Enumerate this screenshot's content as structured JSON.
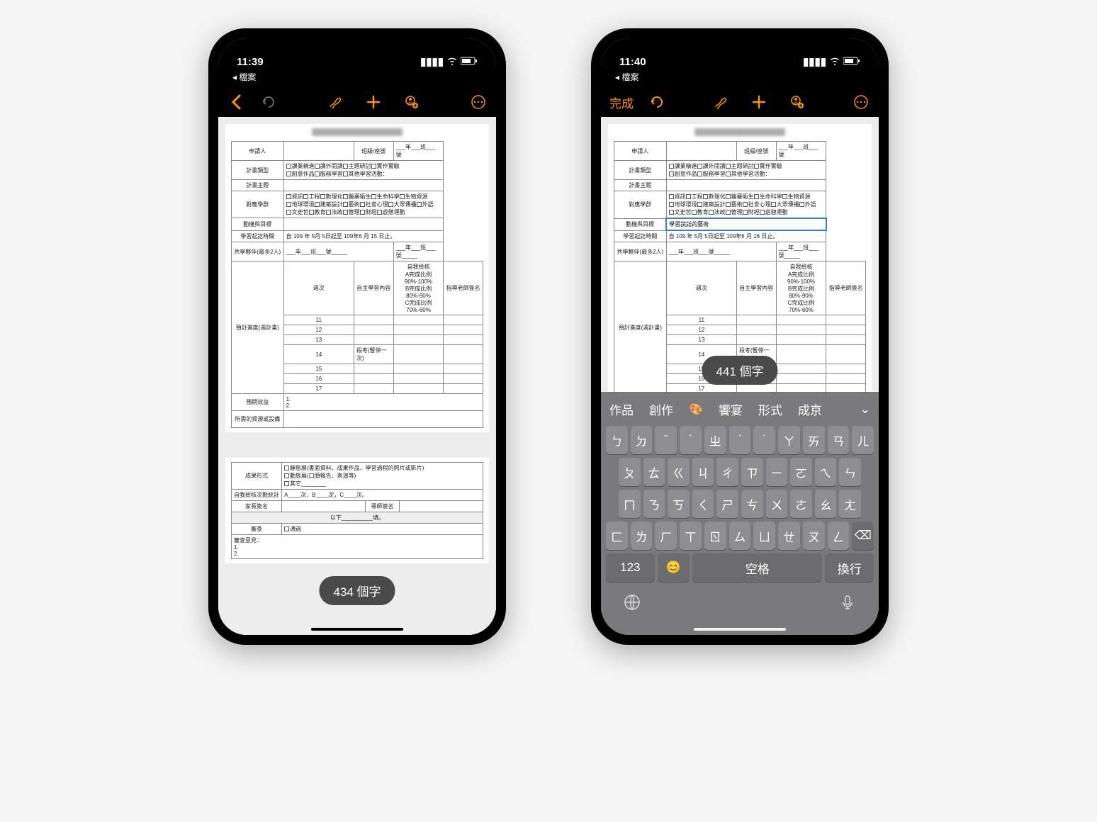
{
  "left": {
    "status_time": "11:39",
    "back_app": "◂ 檔案",
    "word_pill": "434 個字"
  },
  "right": {
    "status_time": "11:40",
    "back_app": "◂ 檔案",
    "done_label": "完成",
    "editing_text": "學習說話的藝術",
    "word_pill": "441 個字"
  },
  "form": {
    "r1_c1": "申請人",
    "r1_c3": "班級/座號",
    "r1_c4": "___年___班___號",
    "r2_c1": "計畫類型",
    "r2_opts": [
      "課業精進",
      "課外閱讀",
      "主題研討",
      "實作實驗",
      "創意作品",
      "服務學習",
      "其他學習活動："
    ],
    "r3_c1": "計畫主題",
    "r4_c1": "對應學群",
    "r4_opts": [
      "資訊",
      "工程",
      "數理化",
      "醫藥衛生",
      "生命科學",
      "生物資源",
      "地球環境",
      "建築設計",
      "藝術",
      "社會心理",
      "大眾傳播",
      "外語",
      "文史哲",
      "教育",
      "法政",
      "管理",
      "財經",
      "遊憩運動"
    ],
    "r5_c1": "動機與目標",
    "r6_c1": "學習起訖時間",
    "r6_c2": "自 109 年 5月 5日起至 109年6 月 15 日止。",
    "r6b_c2": "自 109 年 5月 5日起至 109年6 月 16 日止。",
    "r7_c1": "共學夥伴(最多2人)",
    "r7_c2a": "___年___班___號_____",
    "r7_c2b": "___年___班___號_____",
    "r8_c1": "預計進度(週計畫)",
    "r8_h1": "週次",
    "r8_h2": "自主學習內容",
    "r8_h3": "自我檢核",
    "r8_h3_sub": "A完成比例90%-100%\nB完成比例80%-90%\nC完成比例70%-60%",
    "r8_h4": "指導老師簽名",
    "weeks": [
      "11",
      "12",
      "13",
      "14",
      "15",
      "16",
      "17"
    ],
    "w14_note": "段考(暫停一次)",
    "r9_c1": "預期效益",
    "r9_c2": "1.\n2.",
    "r10_c1": "所需的資源或設備",
    "p2_r1_c1": "成果形式",
    "p2_r1_opts": [
      "靜態展(書面資料、成果作品、學習過程的照片或影片)",
      "動態展(口頭報告、表演等)",
      "其它________"
    ],
    "p2_r2_c1": "自我檢核次數統計",
    "p2_r2_c2": "A____次，B____次，C____次。",
    "p2_r3_c1": "家長簽名",
    "p2_r3_c2": "導師簽名",
    "p2_divider": "以下__________填。",
    "p2_r4_c1": "審查",
    "p2_r4_c2": "通過",
    "p2_r5_c1": "審查意見：\n1.\n2."
  },
  "keyboard": {
    "suggestions": [
      "作品",
      "創作",
      "🎨",
      "饗宴",
      "形式",
      "成京"
    ],
    "row1": [
      "ㄅ",
      "ㄉ",
      "ˇ",
      "ˋ",
      "ㄓ",
      "ˊ",
      "˙",
      "ㄚ",
      "ㄞ",
      "ㄢ",
      "ㄦ"
    ],
    "row2": [
      "ㄆ",
      "ㄊ",
      "ㄍ",
      "ㄐ",
      "ㄔ",
      "ㄗ",
      "ㄧ",
      "ㄛ",
      "ㄟ",
      "ㄣ"
    ],
    "row3": [
      "ㄇ",
      "ㄋ",
      "ㄎ",
      "ㄑ",
      "ㄕ",
      "ㄘ",
      "ㄨ",
      "ㄜ",
      "ㄠ",
      "ㄤ"
    ],
    "row4": [
      "ㄈ",
      "ㄌ",
      "ㄏ",
      "ㄒ",
      "ㄖ",
      "ㄙ",
      "ㄩ",
      "ㄝ",
      "ㄡ",
      "ㄥ",
      "⌫"
    ],
    "num_key": "123",
    "space_label": "空格",
    "return_label": "換行"
  }
}
